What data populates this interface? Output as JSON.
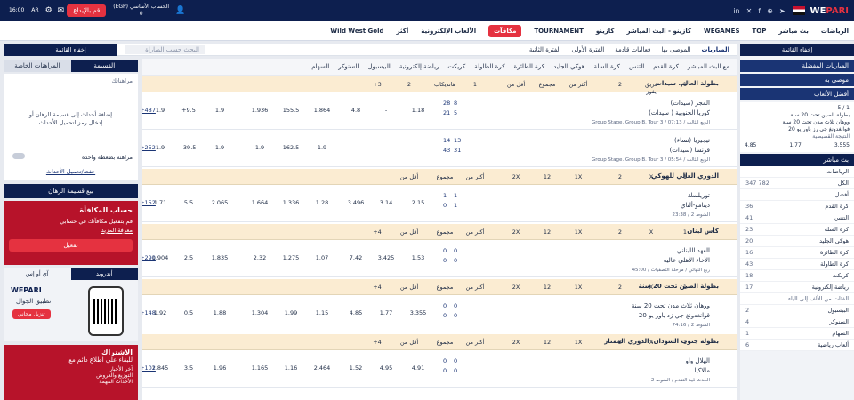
{
  "topbar": {
    "logo_a": "WE",
    "logo_b": "PARI",
    "nav": [
      "الرياضات",
      "بث مباشر",
      "TOP",
      "WEGAMES",
      "كازينو - البث المباشر",
      "كازينو",
      "TOURNAMENT",
      "مكافآت",
      "الألعاب الإلكترونية",
      "أكثر",
      "Wild West Gold"
    ],
    "deposit": "قم بالإيداع",
    "account_label": "الحساب الأساسي (EGP)",
    "balance": "0",
    "time": "16:00",
    "lang": "AR"
  },
  "secondary_nav": [
    "المباريات",
    "الموصى بها",
    "فعاليات قادمة",
    "الفترة الأولى",
    "الفترة الثانية"
  ],
  "search_placeholder": "البحث حسب المباراة",
  "collapse": "إخفاء القائمة",
  "sports_tabs": [
    "مع البث المباشر",
    "كرة القدم",
    "التنس",
    "كرة السلة",
    "هوكي الجليد",
    "كرة الطائرة",
    "كرة الطاولة",
    "كريكت",
    "رياضة إلكترونية",
    "البيسبول",
    "السنوكر",
    "السهام"
  ],
  "betslip": {
    "tab1": "القسيمة",
    "tab2": "المراهنات الخاصة",
    "section": "مراهناتك",
    "empty1": "إضافة أحداث إلى قسيمة الرهان أو",
    "empty2": "إدخال رمز لتحميل الأحداث",
    "one_click": "مراهنة بضغطة واحدة",
    "save": "حفظ/تحميل الأحداث",
    "sell": "بيع قسيمة الرهان"
  },
  "promo": {
    "title": "حساب المكافأة",
    "text": "قم بتفعيل مكافآتك في حسابي",
    "more": "معرفة المزيد",
    "activate": "تفعيل"
  },
  "app": {
    "android": "أندرويد",
    "ios": "آي أو إس",
    "logo": "WEPARI",
    "title": "تطبيق الجوال",
    "install": "تنزيل مجاني"
  },
  "subscribe": {
    "title": "الاشتراك",
    "subtitle": "للبقاء على اطلاع دائم مع",
    "items": [
      "آخر الأخبار",
      "التوزيع والعروض",
      "الأحداث المهمة"
    ]
  },
  "right": {
    "favorites": "المباريات المفضلة",
    "recommended": "موصى به",
    "best_games": "أفضل الألعاب",
    "pager": "1 / 5",
    "match": "بطولة الصين تحت 20 سنة",
    "t1": "ووهان ثلاث مدن تحت 20 سنة",
    "t2": "فوانغدونغ جي رز باور يو 20",
    "result": "النتيجة القصيصية",
    "o1": "3.555",
    "ox": "1.77",
    "o2": "4.85",
    "live": "بث مباشر",
    "sports": "الرياضات",
    "top_live": "الكل",
    "top_count": "782",
    "top_count2": "347",
    "best": "أفضل",
    "list": [
      [
        "كرة القدم",
        "36"
      ],
      [
        "التنس",
        "41"
      ],
      [
        "كرة السلة",
        "23"
      ],
      [
        "هوكي الجليد",
        "20"
      ],
      [
        "كرة الطائرة",
        "16"
      ],
      [
        "كرة الطاولة",
        "43"
      ],
      [
        "كريكت",
        "18"
      ],
      [
        "رياضة إلكترونية",
        "17"
      ]
    ],
    "alpha": "الفئات من الألف إلى الياء",
    "list2": [
      [
        "البيسبول",
        "2"
      ],
      [
        "السنوكر",
        "4"
      ],
      [
        "السهام",
        "1"
      ],
      [
        "ألعاب رياضية",
        "6"
      ]
    ]
  },
  "leagues": [
    {
      "name": "بطولة العالم. سيدات",
      "cols": [
        "1",
        "فريق يفوز",
        "2",
        "أكثر من",
        "مجموع",
        "أقل من",
        "1",
        "هانديكاب",
        "2",
        "+3"
      ],
      "matches": [
        {
          "t1": "المجر (سيدات)",
          "t2": "كوريا الجنوبية ( سيدات)",
          "s1": [
            "28",
            "8"
          ],
          "s2": [
            "21",
            "5"
          ],
          "info": "Group Stage. Group B. Tour 3 / الربع الثالث / 07:13",
          "o": [
            "1.18",
            "-",
            "4.8",
            "1.864",
            "155.5",
            "1.936",
            "1.9",
            "+9.5",
            "1.9",
            "+487"
          ]
        },
        {
          "t1": "نيجيريا (نساء)",
          "t2": "فرنسا (سيدات)",
          "s1": [
            "14",
            "13"
          ],
          "s2": [
            "43",
            "31"
          ],
          "info": "Group Stage. Group B. Tour 3 / الربع الثالث / 05:54",
          "o": [
            "-",
            "-",
            "-",
            "1.9",
            "162.5",
            "1.9",
            "1.9",
            "-39.5",
            "1.9",
            "+252"
          ]
        }
      ]
    },
    {
      "name": "الدوري العالي للهوكي",
      "cols": [
        "1",
        "X",
        "2",
        "1X",
        "12",
        "2X",
        "أكثر من",
        "مجموع",
        "أقل من"
      ],
      "matches": [
        {
          "t1": "توريلسك",
          "t2": "دينامو-ألتاي",
          "s1": [
            "1",
            "1"
          ],
          "s2": [
            "0",
            "1"
          ],
          "info": "الشوط 2 / 23:38",
          "o": [
            "2.15",
            "3.14",
            "3.496",
            "1.28",
            "1.336",
            "1.664",
            "2.065",
            "5.5",
            "1.71",
            "+152"
          ]
        }
      ]
    },
    {
      "name": "كأس لبنان",
      "cols": [
        "1",
        "X",
        "2",
        "1X",
        "12",
        "2X",
        "أكثر من",
        "مجموع",
        "أقل من",
        "+4"
      ],
      "matches": [
        {
          "t1": "العهد اللبناني",
          "t2": "الأخاء الأهلي عاليه",
          "s1": [
            "0",
            "0"
          ],
          "s2": [
            "0",
            "0"
          ],
          "info": "ربع النهائي / مرحلة التصفيات / 45:00",
          "o": [
            "1.53",
            "3.425",
            "7.42",
            "1.07",
            "1.275",
            "2.32",
            "1.835",
            "2.5",
            "1.904",
            "+290"
          ]
        }
      ]
    },
    {
      "name": "بطولة الصين تحت 20 سنة",
      "cols": [
        "1",
        "X",
        "2",
        "1X",
        "12",
        "2X",
        "أكثر من",
        "مجموع",
        "أقل من",
        "+4"
      ],
      "matches": [
        {
          "t1": "ووهان ثلاث مدن تحت 20 سنة",
          "t2": "قوانغدونغ جي زد باور يو 20",
          "s1": [
            "0",
            "0"
          ],
          "s2": [
            "0",
            "0"
          ],
          "info": "الشوط 2 / 74:16",
          "o": [
            "3.355",
            "1.77",
            "4.85",
            "1.15",
            "1.99",
            "1.304",
            "1.88",
            "0.5",
            "1.92",
            "+148"
          ]
        }
      ]
    },
    {
      "name": "بطولة جنوب السودان. الدوري الممتاز",
      "cols": [
        "1",
        "X",
        "2",
        "1X",
        "12",
        "2X",
        "أكثر من",
        "مجموع",
        "أقل من",
        "+4"
      ],
      "matches": [
        {
          "t1": "الهلال واو",
          "t2": "مالاكيا",
          "s1": [
            "0",
            "0"
          ],
          "s2": [
            "0",
            "0"
          ],
          "info": "الحدث قيد التقدم / الشوط 2",
          "o": [
            "4.91",
            "4.95",
            "1.52",
            "2.464",
            "1.16",
            "1.165",
            "1.96",
            "3.5",
            "1.845",
            "+102"
          ]
        }
      ]
    }
  ]
}
